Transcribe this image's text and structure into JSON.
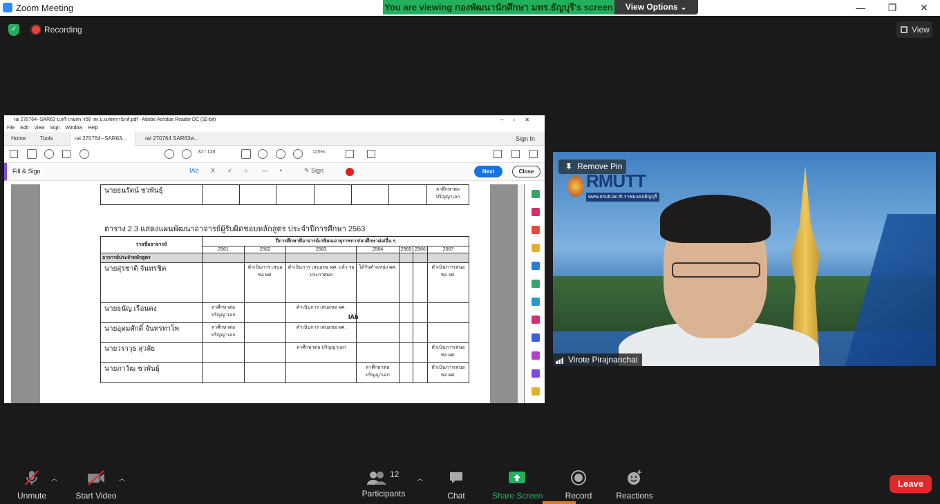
{
  "window": {
    "title": "Zoom Meeting",
    "controls": [
      "—",
      "❐",
      "✕"
    ]
  },
  "share_banner": {
    "text": "You are viewing กองพัฒนานักศึกษา มทร.ธัญบุรี's screen",
    "view_options": "View Options ⌄"
  },
  "status": {
    "recording": "Recording",
    "view": "View"
  },
  "acrobat": {
    "title": "rai 270764--SAR63 ป.ตรี เกษตร ร58 วท.บ.เมชตรานิกส์.pdf - Adobe Acrobat Reader DC (32-bit)",
    "menu": [
      "File",
      "Edit",
      "View",
      "Sign",
      "Window",
      "Help"
    ],
    "tabs": [
      "Home",
      "Tools",
      "rai 270764--SAR63...",
      "rai 270764 SAR63w..."
    ],
    "sign_in": "Sign In",
    "page_current": "32",
    "page_total": "/ 128",
    "zoom": "125%",
    "fill_sign": "Fill & Sign",
    "tools": [
      "IAb",
      "X",
      "✓",
      "○",
      "—",
      "•"
    ],
    "sign_label": "Sign",
    "next": "Next",
    "close": "Close",
    "cursor_text": "IAb"
  },
  "document": {
    "top_row_name": "นายธนรัตน์ ชวพันธุ์",
    "top_row_note": "ลาศึกษาต่อ ปริญญาเอก",
    "table_title": "ตาราง 2.3 แสดงแผนพัฒนาอาจารย์ผู้รับผิดชอบหลักสูตร ประจำปีการศึกษา 2563",
    "col_name": "รายชื่ออาจารย์",
    "col_plan": "ปีการศึกษาที่อาจารย์เกษียณอายุราชการ/ลาศึกษาต่อ/อื่น ๆ",
    "years": [
      "2561",
      "2562",
      "2563",
      "2564",
      "2565",
      "2566",
      "2567"
    ],
    "section": "อาจารย์ประจำหลักสูตร",
    "rows": [
      {
        "name": "นายสุรชาติ จันทรชิต",
        "cells": [
          "",
          "ดำเนินการ เสนอขอ ผศ.",
          "ดำเนินการ เสนอขอ ผศ. แล้ว รอ ประกาศผล",
          "ได้รับตำแหน่ง ผศ.",
          "",
          "",
          "ดำเนินการเสนอ ขอ รศ."
        ]
      },
      {
        "name": "นายธนัญ เรือนคง",
        "cells": [
          "ลาศึกษาต่อ ปริญญาเอก",
          "",
          "ดำเนินการ เสนอขอ ผศ.",
          "",
          "",
          "",
          ""
        ]
      },
      {
        "name": "นายอุดมศักดิ์ จันทรทาโพ",
        "cells": [
          "ลาศึกษาต่อ ปริญญาเอก",
          "",
          "ดำเนินการ เสนอขอ ผศ.",
          "",
          "",
          "",
          ""
        ]
      },
      {
        "name": "นายวราวุธ สุวลัย",
        "cells": [
          "",
          "",
          "ลาศึกษาต่อ ปริญญาเอก",
          "",
          "",
          "",
          "ดำเนินการเสนอ ขอ ผศ."
        ]
      },
      {
        "name": "นายภาวัฒ ชวพันธุ์",
        "cells": [
          "",
          "",
          "",
          "ลาศึกษาต่อ ปริญญาเอก",
          "",
          "",
          "ดำเนินการเสนอ ขอ ผศ."
        ]
      }
    ]
  },
  "video": {
    "remove_pin": "Remove Pin",
    "logo": "RMUTT",
    "logo_sub": "www.rmutt.ac.th  ราชมงคลธัญบุรี",
    "participant_name": "Virote Pirajnanchai"
  },
  "controls": {
    "unmute": "Unmute",
    "start_video": "Start Video",
    "participants": "Participants",
    "participant_count": "12",
    "chat": "Chat",
    "share_screen": "Share Screen",
    "record": "Record",
    "reactions": "Reactions",
    "leave": "Leave"
  }
}
